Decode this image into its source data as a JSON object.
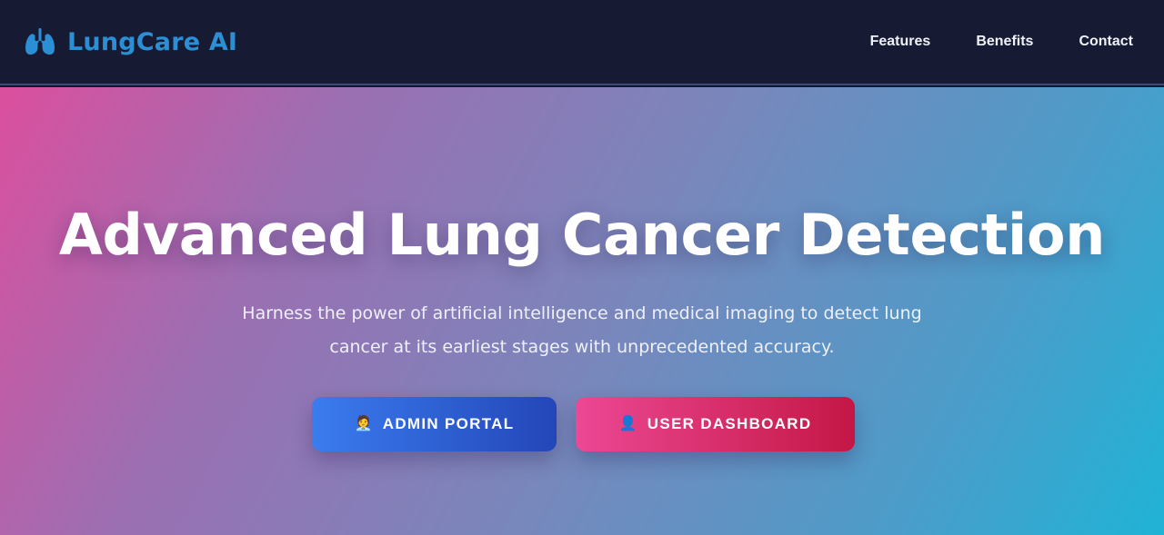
{
  "nav": {
    "brand": "LungCare AI",
    "brand_icon": "lungs-icon",
    "links": [
      {
        "label": "Features"
      },
      {
        "label": "Benefits"
      },
      {
        "label": "Contact"
      }
    ]
  },
  "hero": {
    "title": "Advanced Lung Cancer Detection",
    "subtitle": "Harness the power of artificial intelligence and medical imaging to detect lung cancer at its earliest stages with unprecedented accuracy.",
    "buttons": {
      "admin": {
        "icon": "🧑‍💼",
        "label": "ADMIN PORTAL"
      },
      "user": {
        "icon": "👤",
        "label": "USER DASHBOARD"
      }
    }
  },
  "colors": {
    "nav_bg": "#161b33",
    "brand": "#2b8fd6",
    "admin_button": "#2f60d6",
    "user_button": "#dc2f6c",
    "hero_gradient_start": "#db4f9e",
    "hero_gradient_end": "#1fb3d6"
  }
}
